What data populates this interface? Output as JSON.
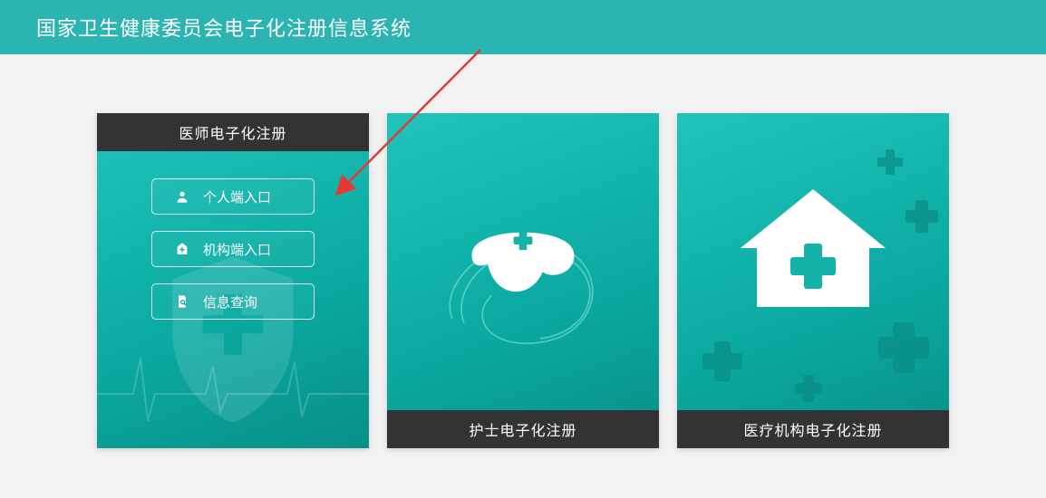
{
  "header": {
    "title": "国家卫生健康委员会电子化注册信息系统"
  },
  "cards": [
    {
      "title": "医师电子化注册",
      "buttons": [
        {
          "label": "个人端入口",
          "icon": "person-icon"
        },
        {
          "label": "机构端入口",
          "icon": "hospital-icon"
        },
        {
          "label": "信息查询",
          "icon": "search-document-icon"
        }
      ]
    },
    {
      "title": "护士电子化注册"
    },
    {
      "title": "医疗机构电子化注册"
    }
  ],
  "colors": {
    "headerTeal": "#2bb4b1",
    "cardTealLight": "#20c4bc",
    "cardTealDark": "#089088",
    "titleBarDark": "#333333",
    "arrowRed": "#e53935"
  }
}
